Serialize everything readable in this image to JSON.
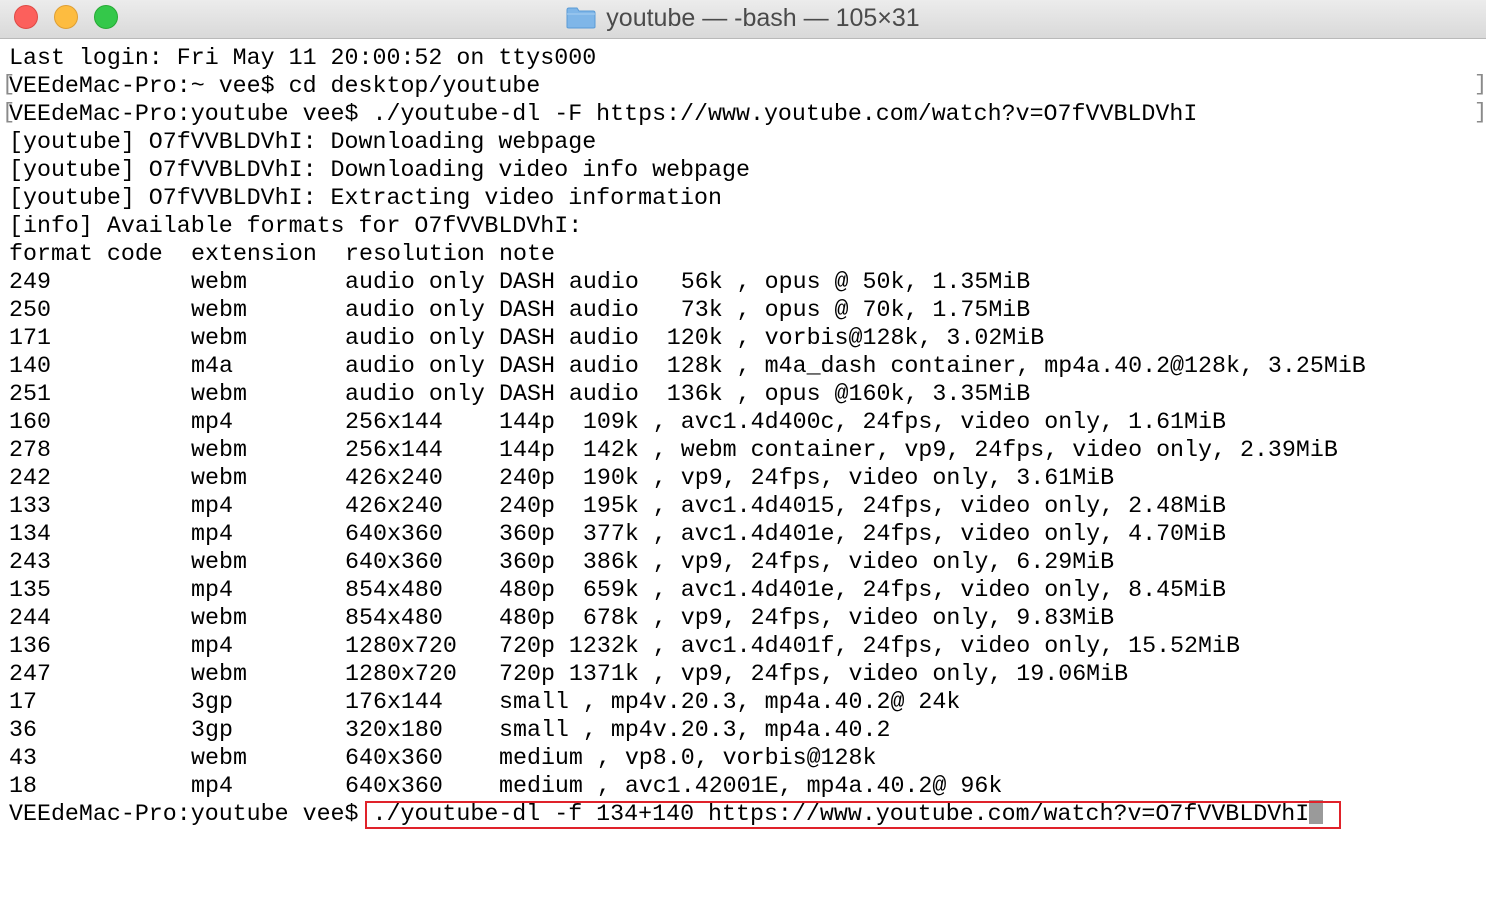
{
  "window": {
    "title": "youtube — -bash — 105×31",
    "folder_icon": "folder-icon"
  },
  "terminal": {
    "header_lines": [
      "Last login: Fri May 11 20:00:52 on ttys000",
      "VEEdeMac-Pro:~ vee$ cd desktop/youtube",
      "VEEdeMac-Pro:youtube vee$ ./youtube-dl -F https://www.youtube.com/watch?v=O7fVVBLDVhI",
      "[youtube] O7fVVBLDVhI: Downloading webpage",
      "[youtube] O7fVVBLDVhI: Downloading video info webpage",
      "[youtube] O7fVVBLDVhI: Extracting video information",
      "[info] Available formats for O7fVVBLDVhI:"
    ],
    "table_header": {
      "format": "format code",
      "extension": "extension",
      "resolution": "resolution",
      "note": "note"
    },
    "formats": [
      {
        "code": "249",
        "ext": "webm",
        "res": "audio only",
        "note": "DASH audio   56k , opus @ 50k, 1.35MiB"
      },
      {
        "code": "250",
        "ext": "webm",
        "res": "audio only",
        "note": "DASH audio   73k , opus @ 70k, 1.75MiB"
      },
      {
        "code": "171",
        "ext": "webm",
        "res": "audio only",
        "note": "DASH audio  120k , vorbis@128k, 3.02MiB"
      },
      {
        "code": "140",
        "ext": "m4a",
        "res": "audio only",
        "note": "DASH audio  128k , m4a_dash container, mp4a.40.2@128k, 3.25MiB"
      },
      {
        "code": "251",
        "ext": "webm",
        "res": "audio only",
        "note": "DASH audio  136k , opus @160k, 3.35MiB"
      },
      {
        "code": "160",
        "ext": "mp4",
        "res": "256x144",
        "note": "144p  109k , avc1.4d400c, 24fps, video only, 1.61MiB"
      },
      {
        "code": "278",
        "ext": "webm",
        "res": "256x144",
        "note": "144p  142k , webm container, vp9, 24fps, video only, 2.39MiB"
      },
      {
        "code": "242",
        "ext": "webm",
        "res": "426x240",
        "note": "240p  190k , vp9, 24fps, video only, 3.61MiB"
      },
      {
        "code": "133",
        "ext": "mp4",
        "res": "426x240",
        "note": "240p  195k , avc1.4d4015, 24fps, video only, 2.48MiB"
      },
      {
        "code": "134",
        "ext": "mp4",
        "res": "640x360",
        "note": "360p  377k , avc1.4d401e, 24fps, video only, 4.70MiB"
      },
      {
        "code": "243",
        "ext": "webm",
        "res": "640x360",
        "note": "360p  386k , vp9, 24fps, video only, 6.29MiB"
      },
      {
        "code": "135",
        "ext": "mp4",
        "res": "854x480",
        "note": "480p  659k , avc1.4d401e, 24fps, video only, 8.45MiB"
      },
      {
        "code": "244",
        "ext": "webm",
        "res": "854x480",
        "note": "480p  678k , vp9, 24fps, video only, 9.83MiB"
      },
      {
        "code": "136",
        "ext": "mp4",
        "res": "1280x720",
        "note": "720p 1232k , avc1.4d401f, 24fps, video only, 15.52MiB"
      },
      {
        "code": "247",
        "ext": "webm",
        "res": "1280x720",
        "note": "720p 1371k , vp9, 24fps, video only, 19.06MiB"
      },
      {
        "code": "17",
        "ext": "3gp",
        "res": "176x144",
        "note": "small , mp4v.20.3, mp4a.40.2@ 24k"
      },
      {
        "code": "36",
        "ext": "3gp",
        "res": "320x180",
        "note": "small , mp4v.20.3, mp4a.40.2"
      },
      {
        "code": "43",
        "ext": "webm",
        "res": "640x360",
        "note": "medium , vp8.0, vorbis@128k"
      },
      {
        "code": "18",
        "ext": "mp4",
        "res": "640x360",
        "note": "medium , avc1.42001E, mp4a.40.2@ 96k"
      }
    ],
    "prompt": "VEEdeMac-Pro:youtube vee$ ",
    "current_command": "./youtube-dl -f 134+140 https://www.youtube.com/watch?v=O7fVVBLDVhI",
    "wrap_marker_left": "[",
    "wrap_marker_right": "]"
  }
}
